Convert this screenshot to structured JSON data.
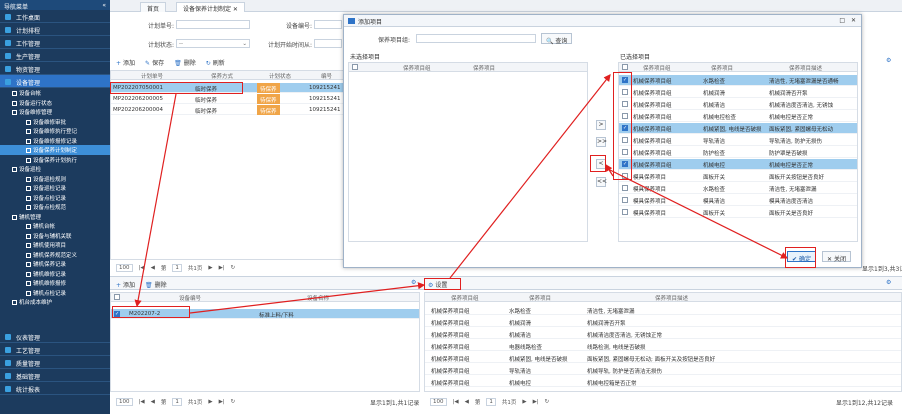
{
  "sidebar": {
    "header": "导航菜单",
    "collapse": "«",
    "top_items": [
      {
        "label": "工作桌面"
      },
      {
        "label": "计划排程"
      },
      {
        "label": "工作管理"
      },
      {
        "label": "生产管理"
      },
      {
        "label": "物资管理"
      },
      {
        "label": "设备管理",
        "active": true
      }
    ],
    "sub_items": [
      {
        "label": "设备台帐",
        "level": 1
      },
      {
        "label": "设备运行状态",
        "level": 1
      },
      {
        "label": "设备维修管理",
        "level": 1
      },
      {
        "label": "设备维修审批",
        "level": 2
      },
      {
        "label": "设备维修执行登记",
        "level": 2
      },
      {
        "label": "设备维修报修记录",
        "level": 2
      },
      {
        "label": "设备保养计划制定",
        "level": 2,
        "selected": true
      },
      {
        "label": "设备保养计划执行",
        "level": 2
      },
      {
        "label": "设备巡检",
        "level": 1
      },
      {
        "label": "设备巡检规则",
        "level": 2
      },
      {
        "label": "设备巡检记录",
        "level": 2
      },
      {
        "label": "设备点检记录",
        "level": 2
      },
      {
        "label": "设备点检规范",
        "level": 2
      },
      {
        "label": "辅机管理",
        "level": 1
      },
      {
        "label": "辅机台帐",
        "level": 2
      },
      {
        "label": "设备与辅机关联",
        "level": 2
      },
      {
        "label": "辅机使用项目",
        "level": 2
      },
      {
        "label": "辅机保养规范定义",
        "level": 2
      },
      {
        "label": "辅机保养记录",
        "level": 2
      },
      {
        "label": "辅机维修记录",
        "level": 2
      },
      {
        "label": "辅机维修报修",
        "level": 2
      },
      {
        "label": "辅机点检记录",
        "level": 2
      },
      {
        "label": "机台成本维护",
        "level": 1
      }
    ],
    "bottom_items": [
      {
        "label": "仪表管理"
      },
      {
        "label": "工艺管理"
      },
      {
        "label": "质量管理"
      },
      {
        "label": "基础管理"
      },
      {
        "label": "统计报表"
      }
    ]
  },
  "tabs": [
    {
      "label": "首页"
    },
    {
      "label": "设备保养计划制定 ✕",
      "active": true
    }
  ],
  "form": {
    "plan_no_label": "计划单号:",
    "device_no_label": "设备编号:",
    "plan_status_label": "计划状态:",
    "plan_status_value": "--",
    "plan_start_label": "计划开始时间从:"
  },
  "toolbar": {
    "add": "添加",
    "save": "保存",
    "delete": "删除",
    "refresh": "刷新"
  },
  "plan_grid": {
    "headers": [
      "计划单号",
      "保养方式",
      "计划状态",
      "编号"
    ],
    "rows": [
      {
        "plan_no": "MP202207050001",
        "method": "临时保养",
        "status": "待保养",
        "code": "109215241",
        "selected": true
      },
      {
        "plan_no": "MP202206200005",
        "method": "临时保养",
        "status": "待保养",
        "code": "109215241"
      },
      {
        "plan_no": "MP202206200004",
        "method": "临时保养",
        "status": "待保养",
        "code": "109215241"
      }
    ]
  },
  "pager_top": {
    "size": "100",
    "page_prefix": "第",
    "page": "1",
    "total": "共1页",
    "info": "显示1到3,共3记录"
  },
  "lower_toolbar": {
    "add": "添加",
    "delete": "删除",
    "settings": "设置"
  },
  "device_grid": {
    "headers": [
      "设备编号",
      "设备名称"
    ],
    "rows": [
      {
        "device_no": "M202207-2",
        "name": "标准上料/下料",
        "checked": true
      }
    ]
  },
  "item_grid": {
    "headers": [
      "保养项目组",
      "保养项目",
      "保养项目描述"
    ],
    "rows": [
      {
        "group": "机械保养项目组",
        "item": "水路检查",
        "desc": "清洁性, 无堵塞泄漏"
      },
      {
        "group": "机械保养项目组",
        "item": "机械润滑",
        "desc": "机械润滑否开泵"
      },
      {
        "group": "机械保养项目组",
        "item": "机械清洁",
        "desc": "机械清洁度否清洁, 无锈蚀正常"
      },
      {
        "group": "机械保养项目组",
        "item": "电器线路检查",
        "desc": "线路检测, 电线是否破损"
      },
      {
        "group": "机械保养项目组",
        "item": "机械紧固, 电线是否破损",
        "desc": "面板紧固, 紧固螺母无松动; 面板开关及按钮是否良好"
      },
      {
        "group": "机械保养项目组",
        "item": "导轨清洁",
        "desc": "机械导轨, 防护是否清洁无损伤"
      },
      {
        "group": "机械保养项目组",
        "item": "机械电控",
        "desc": "机械电控箱是否正常"
      }
    ]
  },
  "pager_bottom": {
    "size": "100",
    "page_prefix": "第",
    "page": "1",
    "total": "共1页",
    "info_left": "显示1到1,共1记录",
    "info_right": "显示1到12,共12记录"
  },
  "dialog": {
    "title": "添加项目",
    "close": "✕",
    "maximize": "□",
    "search_label": "保养项目组:",
    "search_button": "查询",
    "left_title": "未选择项目",
    "left_headers": [
      "保养项目组",
      "保养项目"
    ],
    "right_title": "已选择项目",
    "right_headers": [
      "保养项目组",
      "保养项目",
      "保养项目描述"
    ],
    "move_buttons": [
      ">",
      ">>",
      "<",
      "<<"
    ],
    "right_rows": [
      {
        "group": "机械保养项目组",
        "item": "水路检查",
        "desc": "清洁性, 无堵塞泄漏是否通畅",
        "checked": true,
        "selected": true
      },
      {
        "group": "机械保养项目组",
        "item": "机械润滑",
        "desc": "机械润滑否开泵",
        "checked": false
      },
      {
        "group": "机械保养项目组",
        "item": "机械清洁",
        "desc": "机械清洁度否清洁, 无锈蚀",
        "checked": false
      },
      {
        "group": "机械保养项目组",
        "item": "机械电控检查",
        "desc": "机械电控是否正常",
        "checked": false
      },
      {
        "group": "机械保养项目组",
        "item": "机械紧固, 电线是否破损",
        "desc": "面板紧固, 紧固螺母无松动",
        "checked": true,
        "selected": true
      },
      {
        "group": "机械保养项目组",
        "item": "导轨清洁",
        "desc": "导轨清洁, 防护无损伤",
        "checked": false
      },
      {
        "group": "机械保养项目组",
        "item": "防护检查",
        "desc": "防护罩是否破损",
        "checked": false
      },
      {
        "group": "机械保养项目组",
        "item": "机械电控",
        "desc": "机械电控是否正常",
        "checked": true,
        "selected": true
      },
      {
        "group": "模具保养项目",
        "item": "面板开关",
        "desc": "面板开关按钮是否良好",
        "checked": false
      },
      {
        "group": "模具保养项目",
        "item": "水路检查",
        "desc": "清洁性, 无堵塞泄漏",
        "checked": false
      },
      {
        "group": "模具保养项目",
        "item": "模具清洁",
        "desc": "模具清洁度否清洁",
        "checked": false
      },
      {
        "group": "模具保养项目",
        "item": "面板开关",
        "desc": "面板开关是否良好",
        "checked": false
      }
    ],
    "ok_button": "确定",
    "close_button": "关闭"
  }
}
